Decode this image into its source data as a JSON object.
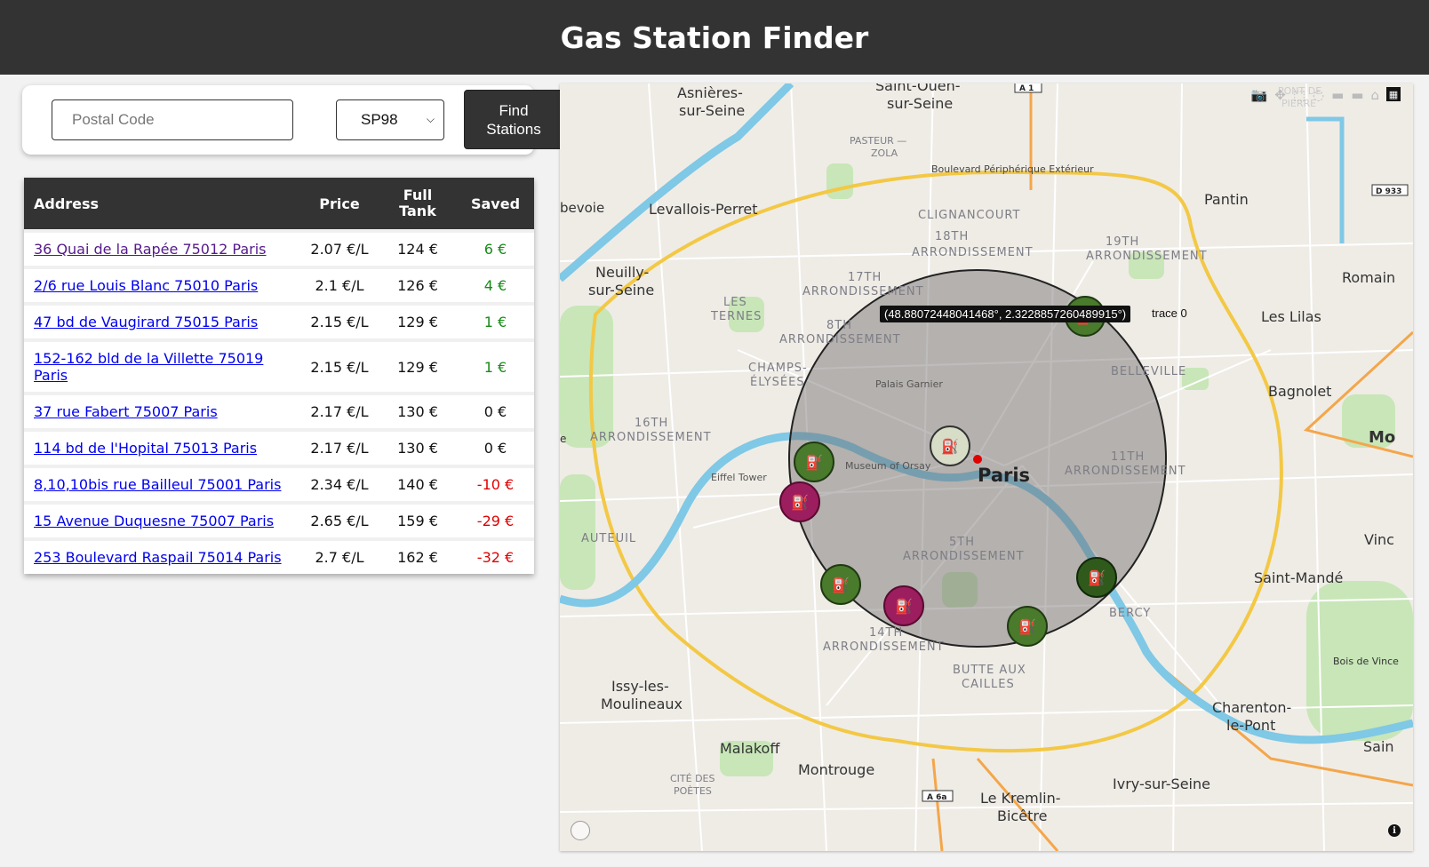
{
  "header": {
    "title": "Gas Station Finder"
  },
  "search": {
    "postal_placeholder": "Postal Code",
    "postal_value": "",
    "fuel_selected": "SP98",
    "find_label_line1": "Find",
    "find_label_line2": "Stations"
  },
  "table": {
    "headers": {
      "address": "Address",
      "price": "Price",
      "full_line1": "Full",
      "full_line2": "Tank",
      "saved": "Saved"
    },
    "rows": [
      {
        "address": "36 Quai de la Rapée 75012 Paris",
        "price": "2.07 €/L",
        "full": "124 €",
        "saved": "6 €",
        "saved_class": "pos"
      },
      {
        "address": "2/6 rue Louis Blanc 75010 Paris",
        "price": "2.1 €/L",
        "full": "126 €",
        "saved": "4 €",
        "saved_class": "pos"
      },
      {
        "address": "47 bd de Vaugirard 75015 Paris",
        "price": "2.15 €/L",
        "full": "129 €",
        "saved": "1 €",
        "saved_class": "pos"
      },
      {
        "address": "152-162 bld de la Villette 75019 Paris",
        "price": "2.15 €/L",
        "full": "129 €",
        "saved": "1 €",
        "saved_class": "pos"
      },
      {
        "address": "37 rue Fabert 75007 Paris",
        "price": "2.17 €/L",
        "full": "130 €",
        "saved": "0 €",
        "saved_class": "zero"
      },
      {
        "address": "114 bd de l'Hopital 75013 Paris",
        "price": "2.17 €/L",
        "full": "130 €",
        "saved": "0 €",
        "saved_class": "zero"
      },
      {
        "address": "8,10,10bis rue Bailleul 75001 Paris",
        "price": "2.34 €/L",
        "full": "140 €",
        "saved": "-10 €",
        "saved_class": "neg"
      },
      {
        "address": "15 Avenue Duquesne 75007 Paris",
        "price": "2.65 €/L",
        "full": "159 €",
        "saved": "-29 €",
        "saved_class": "neg"
      },
      {
        "address": "253 Boulevard Raspail 75014 Paris",
        "price": "2.7 €/L",
        "full": "162 €",
        "saved": "-32 €",
        "saved_class": "neg"
      }
    ]
  },
  "map": {
    "hover_coords": "(48.88072448041468°, 2.3228857260489915°)",
    "hover_trace": "trace 0",
    "labels": {
      "paris": "Paris",
      "asnieres1": "Asnières-",
      "asnieres2": "sur-Seine",
      "saintouen1": "Saint-Ouen-",
      "saintouen2": "sur-Seine",
      "levallois": "Levallois-Perret",
      "neuilly1": "Neuilly-",
      "neuilly2": "sur-Seine",
      "pantin": "Pantin",
      "romain": "Romain",
      "leslilas": "Les Lilas",
      "bagnolet": "Bagnolet",
      "mo": "Mo",
      "vinc": "Vinc",
      "saintmande": "Saint-Mandé",
      "issy1": "Issy-les-",
      "issy2": "Moulineaux",
      "malakoff": "Malakoff",
      "montrouge": "Montrouge",
      "kremlin1": "Le Kremlin-",
      "kremlin2": "Bicêtre",
      "ivry": "Ivry-sur-Seine",
      "charenton1": "Charenton-",
      "charenton2": "le-Pont",
      "sain": "Sain",
      "boisvinc": "Bois de Vince",
      "clignancourt": "CLIGNANCOURT",
      "arr18a": "18TH",
      "arr18b": "ARRONDISSEMENT",
      "arr19a": "19TH",
      "arr19b": "ARRONDISSEMENT",
      "arr17a": "17TH",
      "arr17b": "ARRONDISSEMENT",
      "arr8a": "8TH",
      "arr8b": "ARRONDISSEMENT",
      "arr16a": "16TH",
      "arr16b": "ARRONDISSEMENT",
      "arr11a": "11TH",
      "arr11b": "ARRONDISSEMENT",
      "arr5a": "5TH",
      "arr5b": "ARRONDISSEMENT",
      "arr14a": "14TH",
      "arr14b": "ARRONDISSEMENT",
      "lesternes1": "LES",
      "lesternes2": "TERNES",
      "champs1": "CHAMPS-",
      "champs2": "ÉLYSÉES",
      "belleville": "BELLEVILLE",
      "auteuil": "AUTEUIL",
      "bercy": "BERCY",
      "butte1": "BUTTE AUX",
      "butte2": "CAILLES",
      "pasteur1": "PASTEUR —",
      "pasteur2": "ZOLA",
      "citepoetes1": "CITÉ DES",
      "citepoetes2": "POÈTES",
      "pierre1": "PONT DE",
      "pierre2": "PIERRE",
      "peripherique": "Boulevard Périphérique Extérieur",
      "palaisgarnier": "Palais Garnier",
      "orsay": "Museum of Orsay",
      "eiffel": "Eiffel Tower",
      "bevoie": "bevoie",
      "a1": "A 1",
      "d933": "D 933",
      "a6a": "A 6a",
      "e": "e"
    },
    "colors": {
      "good": "#4a7a2c",
      "mid": "#d8ddc8",
      "bad": "#9c1e5e",
      "circle": "#6f6a6a"
    }
  }
}
